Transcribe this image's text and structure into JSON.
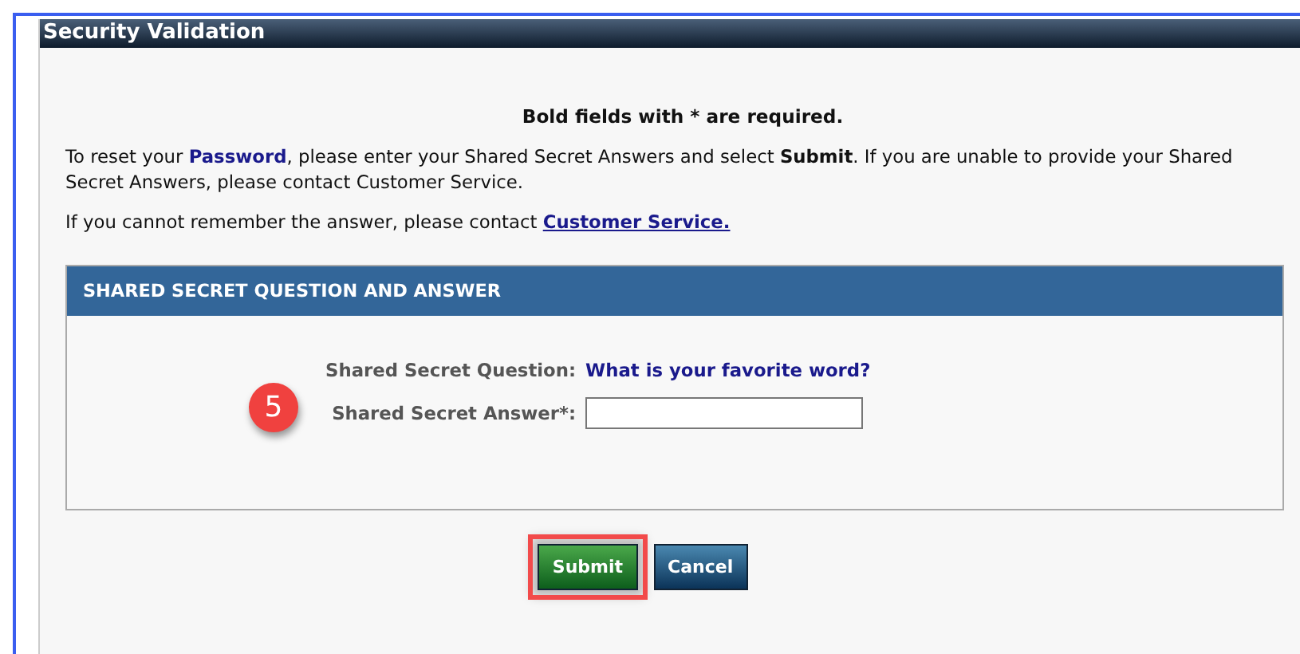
{
  "window": {
    "title": "Security Validation"
  },
  "required_note": "Bold fields with * are required.",
  "intro": [
    {
      "kind": "text",
      "text": "To reset your "
    },
    {
      "kind": "term",
      "text": "Password"
    },
    {
      "kind": "text",
      "text": ", please enter your Shared Secret Answers and select "
    },
    {
      "kind": "strong",
      "text": "Submit"
    },
    {
      "kind": "text",
      "text": ". If you are unable to provide your Shared Secret Answers, please contact Customer Service."
    }
  ],
  "contact": {
    "text": "If you cannot remember the answer, please contact ",
    "link": "Customer Service."
  },
  "section": {
    "title": "SHARED SECRET QUESTION AND ANSWER",
    "question_label": "Shared Secret Question:",
    "question": "What is your favorite word?",
    "answer_label": "Shared Secret Answer*:"
  },
  "step_badge": "5",
  "buttons": [
    {
      "label": "Submit",
      "kind": "primary",
      "highlighted": true
    },
    {
      "label": "Cancel",
      "kind": "secondary",
      "highlighted": false
    }
  ]
}
